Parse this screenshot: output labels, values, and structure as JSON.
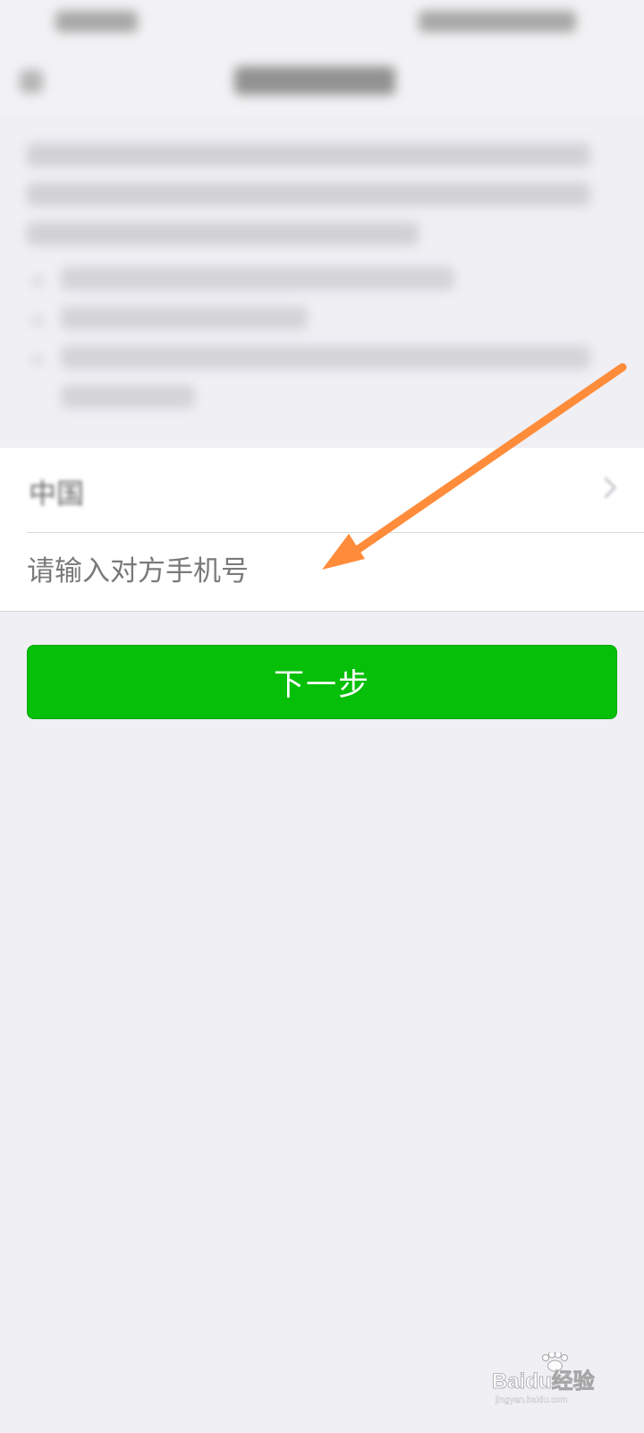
{
  "region": {
    "label": "中国"
  },
  "phone_input": {
    "placeholder": "请输入对方手机号",
    "value": ""
  },
  "next_button": {
    "label": "下一步"
  },
  "watermark": {
    "text": "Baidu经验",
    "sub_text": "jingyan.baidu.com"
  },
  "colors": {
    "background": "#EFEFF4",
    "button_green": "#05BF09",
    "annotation_arrow": "#FF8C3A"
  },
  "icons": {
    "back": "back-arrow-icon",
    "chevron": "chevron-right-icon",
    "annotation": "orange-arrow-annotation"
  }
}
